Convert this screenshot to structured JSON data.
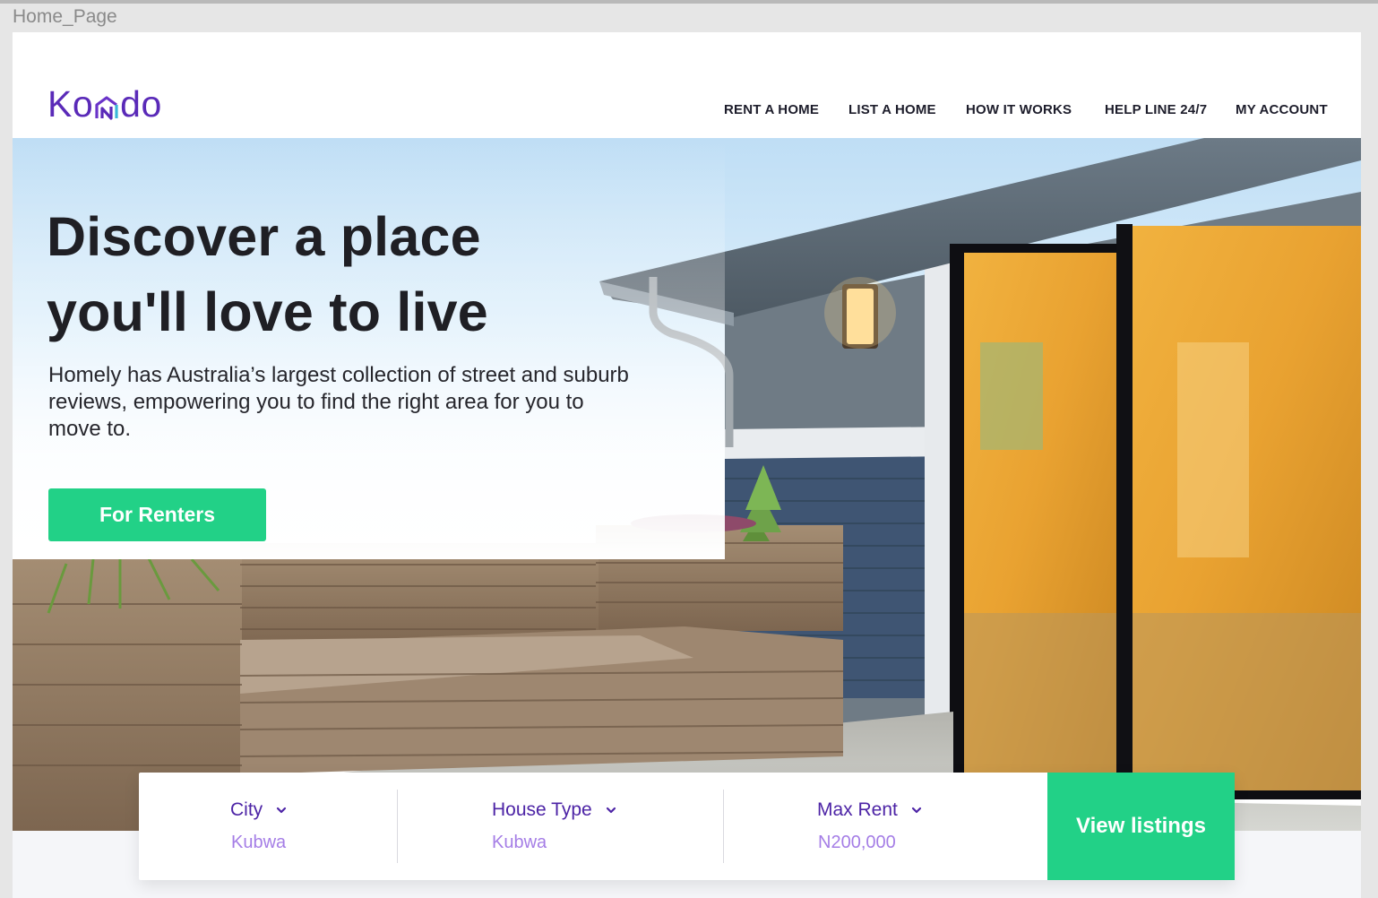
{
  "frame": {
    "label": "Home_Page"
  },
  "brand": {
    "logo_prefix": "Ko",
    "logo_suffix": "do",
    "logo_color": "#5a2ab8"
  },
  "nav": {
    "items": [
      {
        "label": "RENT A HOME"
      },
      {
        "label": "LIST A HOME"
      },
      {
        "label": "HOW IT WORKS"
      },
      {
        "label": "HELP LINE 24/7"
      },
      {
        "label": "MY ACCOUNT"
      }
    ]
  },
  "hero": {
    "headline_line1": "Discover a place",
    "headline_line2": "you'll love to live",
    "subtext": "Homely has Australia’s largest collection of street and suburb reviews, empowering you to find the right area for you to move to.",
    "cta_label": "For Renters"
  },
  "search": {
    "fields": [
      {
        "label": "City",
        "value": "Kubwa",
        "icon": "chevron-down-icon"
      },
      {
        "label": "House Type",
        "value": "Kubwa",
        "icon": "chevron-down-icon"
      },
      {
        "label": "Max Rent",
        "value": "N200,000",
        "icon": "chevron-down-icon"
      }
    ],
    "button_label": "View listings"
  },
  "colors": {
    "accent_green": "#22d187",
    "brand_purple": "#5a2ab8",
    "value_purple": "#a57ee6",
    "text_dark": "#1f1f24"
  }
}
